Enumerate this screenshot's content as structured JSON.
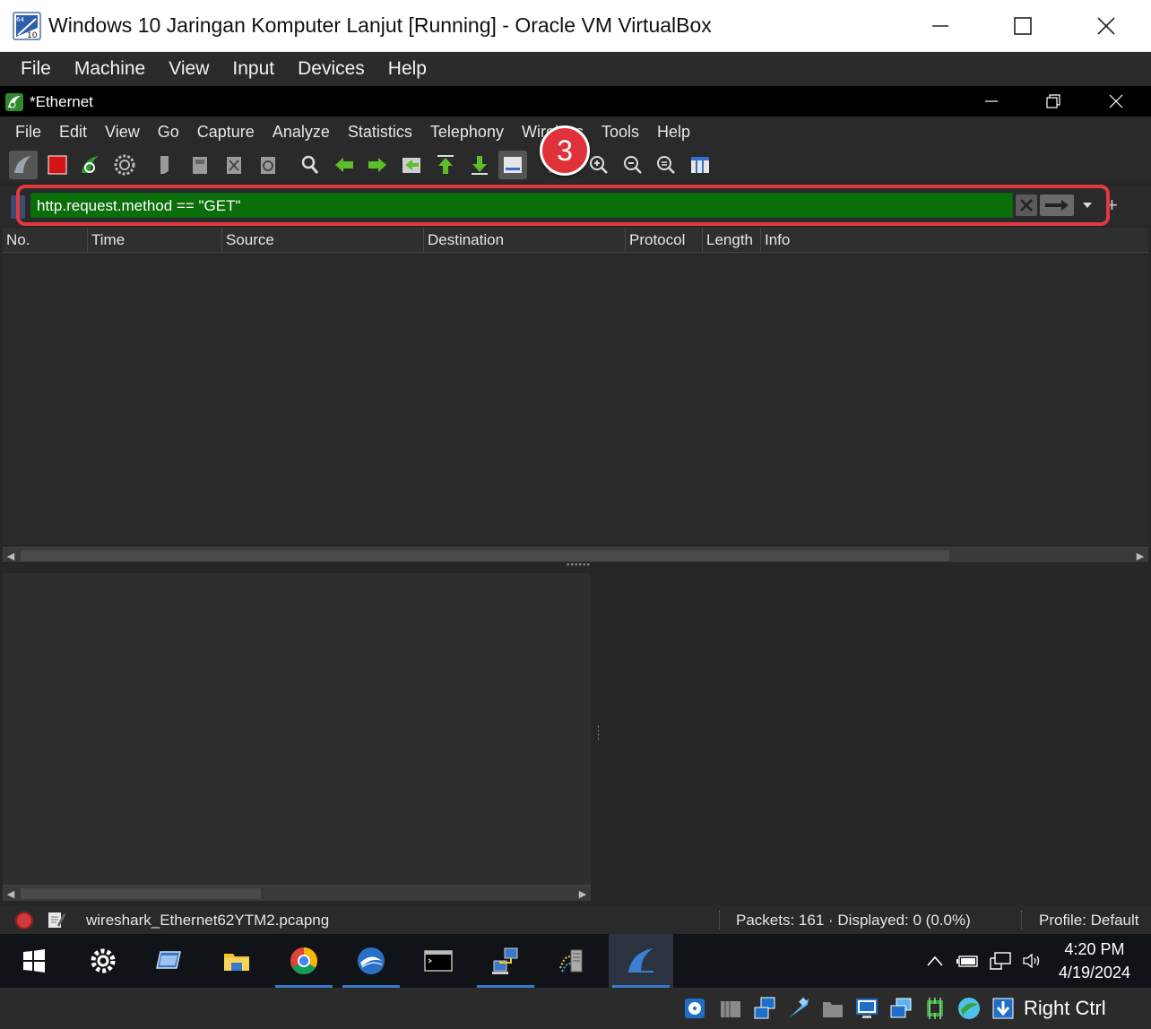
{
  "host_window": {
    "title": "Windows 10 Jaringan Komputer Lanjut [Running] - Oracle VM VirtualBox",
    "menu": [
      "File",
      "Machine",
      "View",
      "Input",
      "Devices",
      "Help"
    ],
    "app_icon_label_top": "64",
    "app_icon_label_bottom": "10"
  },
  "wireshark": {
    "title": "*Ethernet",
    "menu": [
      "File",
      "Edit",
      "View",
      "Go",
      "Capture",
      "Analyze",
      "Statistics",
      "Telephony",
      "Wireless",
      "Tools",
      "Help"
    ],
    "step_badge": "3",
    "filter": {
      "value": "http.request.method == \"GET\"",
      "background_color": "#0a6e0a",
      "highlight_color": "#e03a3e"
    },
    "packet_list": {
      "columns": [
        "No.",
        "Time",
        "Source",
        "Destination",
        "Protocol",
        "Length",
        "Info"
      ],
      "rows": []
    },
    "status": {
      "file": "wireshark_Ethernet62YTM2.pcapng",
      "packets": "Packets: 161 · Displayed: 0 (0.0%)",
      "profile": "Profile: Default"
    }
  },
  "guest_taskbar": {
    "time": "4:20 PM",
    "date": "4/19/2024",
    "apps": [
      "start-icon",
      "settings-icon",
      "remote-desktop-icon",
      "file-explorer-icon",
      "chrome-icon",
      "hyper-icon",
      "terminal-icon",
      "network-icon",
      "server-icon",
      "wireshark-icon"
    ]
  },
  "vbox_status": {
    "host_key": "Right Ctrl"
  },
  "colors": {
    "badge": "#e0323a",
    "accent": "#3a78c8"
  }
}
